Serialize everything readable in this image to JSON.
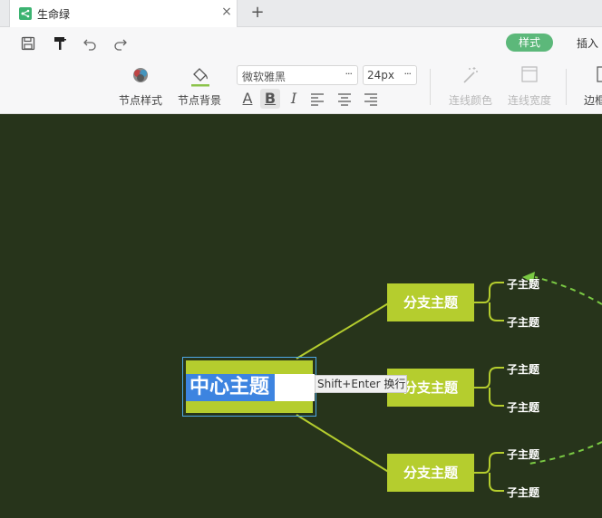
{
  "tab": {
    "title": "生命绿",
    "close_glyph": "×",
    "new_glyph": "+"
  },
  "colors": {
    "accent": "#5cb87a",
    "canvas": "#27341b",
    "node": "#b5cd2e",
    "selection": "#3d84e0",
    "connector": "#b5cd2e",
    "dashed": "#7ac943"
  },
  "quick_access": [
    {
      "name": "save-icon"
    },
    {
      "name": "format-painter-icon"
    },
    {
      "name": "undo-icon"
    },
    {
      "name": "redo-icon"
    }
  ],
  "ribbon_tabs": {
    "style": "样式",
    "insert": "插入"
  },
  "tools": {
    "node_style": "节点样式",
    "node_background": "节点背景",
    "line_color": "连线颜色",
    "line_width": "连线宽度",
    "border": "边框"
  },
  "font": {
    "family": "微软雅黑",
    "size": "24px",
    "more": "···"
  },
  "format_buttons": [
    {
      "name": "font-color-icon",
      "glyph": "A"
    },
    {
      "name": "bold-button",
      "glyph": "B",
      "active": true
    },
    {
      "name": "italic-button",
      "glyph": "I"
    },
    {
      "name": "align-left-icon"
    },
    {
      "name": "align-center-icon"
    },
    {
      "name": "align-right-icon"
    }
  ],
  "mindmap": {
    "center": "中心主题",
    "tooltip": "Shift+Enter 换行",
    "branches": [
      {
        "label": "分支主题",
        "children": [
          "子主题",
          "子主题"
        ]
      },
      {
        "label": "分支主题",
        "children": [
          "子主题",
          "子主题"
        ]
      },
      {
        "label": "分支主题",
        "children": [
          "子主题",
          "子主题"
        ]
      }
    ]
  }
}
